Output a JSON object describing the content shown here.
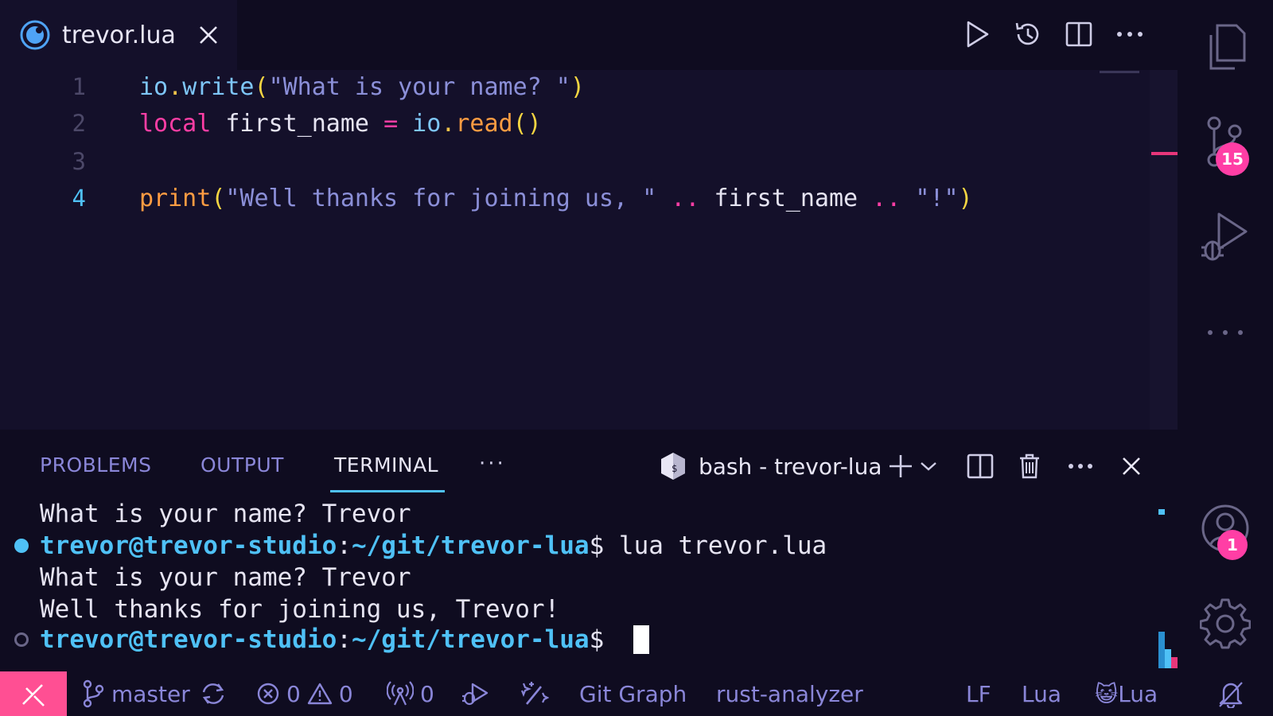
{
  "tab": {
    "title": "trevor.lua"
  },
  "editor": {
    "line_numbers": [
      "1",
      "2",
      "3",
      "4"
    ],
    "lines": [
      [
        "io",
        ".",
        "write",
        "(",
        "\"What is your name? \"",
        ")"
      ],
      [
        "local",
        " first_name ",
        "=",
        " io",
        ".",
        "read",
        "()"
      ],
      [],
      [
        "print",
        "(",
        "\"Well thanks for joining us, \"",
        " ..",
        " first_name ",
        "..",
        " \"!\"",
        ")"
      ]
    ]
  },
  "panel": {
    "tabs": [
      "PROBLEMS",
      "OUTPUT",
      "TERMINAL"
    ],
    "more": "···",
    "shell": "bash - trevor-lua"
  },
  "terminal": {
    "line1": "What is your name? Trevor",
    "prompt_user": "trevor@trevor-studio",
    "prompt_colon": ":",
    "prompt_path": "~/git/trevor-lua",
    "prompt_dollar": "$ ",
    "command": "lua trevor.lua",
    "line3": "What is your name? Trevor",
    "line4": "Well thanks for joining us, Trevor!"
  },
  "activity": {
    "source_control_badge": "15",
    "accounts_badge": "1"
  },
  "status": {
    "branch": "master",
    "errors": "0",
    "warnings": "0",
    "ports": "0",
    "git_graph": "Git Graph",
    "rust_analyzer": "rust-analyzer",
    "eol": "LF",
    "language": "Lua",
    "extension_lua": "😺Lua"
  },
  "colors": {
    "accent": "#4fc1f6",
    "badge": "#ff3ea5",
    "remote": "#ff4f93",
    "bg": "#14102a"
  }
}
